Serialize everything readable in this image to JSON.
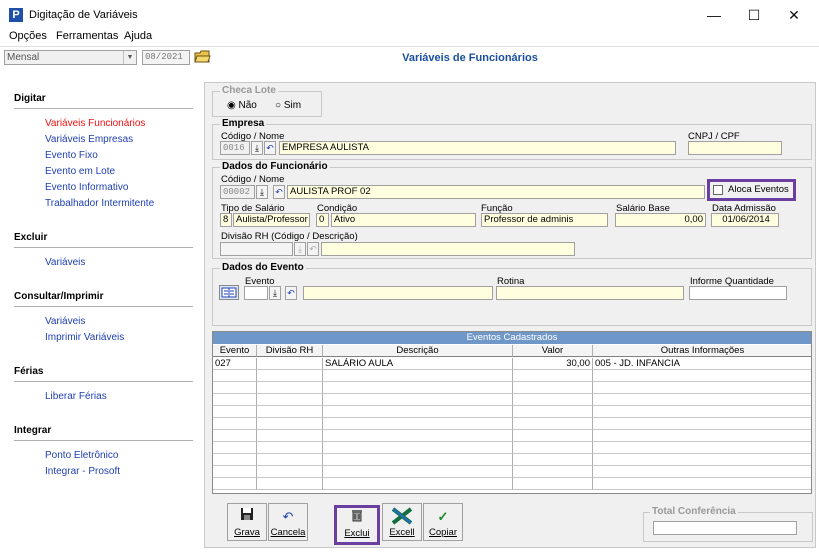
{
  "window": {
    "title": "Digitação de Variáveis",
    "app_icon": "P",
    "minimize": "—",
    "maximize": "☐",
    "close": "✕"
  },
  "menu": [
    "Opções",
    "Ferramentas",
    "Ajuda"
  ],
  "toolbar": {
    "period": "Mensal",
    "date": "08/2021",
    "heading": "Variáveis de Funcionários"
  },
  "sidebar": {
    "sections": [
      {
        "title": "Digitar",
        "items": [
          "Variáveis Funcionários",
          "Variáveis Empresas",
          "Evento Fixo",
          "Evento em Lote",
          "Evento Informativo",
          "Trabalhador Intermitente"
        ]
      },
      {
        "title": "Excluir",
        "items": [
          "Variáveis"
        ]
      },
      {
        "title": "Consultar/Imprimir",
        "items": [
          "Variáveis",
          "Imprimir Variáveis"
        ]
      },
      {
        "title": "Férias",
        "items": [
          "Liberar Férias"
        ]
      },
      {
        "title": "Integrar",
        "items": [
          "Ponto Eletrônico",
          "Integrar - Prosoft"
        ]
      }
    ]
  },
  "checa_lote": {
    "title": "Checa Lote",
    "no_label": "Não",
    "yes_label": "Sim",
    "selected": "Não"
  },
  "empresa": {
    "title": "Empresa",
    "code_label": "Código / Nome",
    "code": "0016",
    "name": "EMPRESA AULISTA",
    "cnpj_label": "CNPJ / CPF",
    "cnpj": ""
  },
  "funcionario": {
    "title": "Dados do Funcionário",
    "code_label": "Código / Nome",
    "code": "00002",
    "name": "AULISTA PROF 02",
    "aloca_label": "Aloca Eventos",
    "tipo_label": "Tipo de Salário",
    "tipo_code": "8",
    "tipo_name": "Aulista/Professor",
    "condicao_label": "Condição",
    "condicao_code": "0",
    "condicao_name": "Ativo",
    "funcao_label": "Função",
    "funcao": "Professor de adminis",
    "salario_label": "Salário Base",
    "salario": "0,00",
    "admissao_label": "Data Admissão",
    "admissao": "01/06/2014",
    "divisao_label": "Divisão RH (Código / Descrição)"
  },
  "evento": {
    "title": "Dados do Evento",
    "evento_label": "Evento",
    "rotina_label": "Rotina",
    "quantidade_label": "Informe Quantidade"
  },
  "grid": {
    "caption": "Eventos Cadastrados",
    "columns": [
      "Evento",
      "Divisão RH",
      "Descrição",
      "Valor",
      "Outras Informações"
    ],
    "rows": [
      [
        "027",
        "",
        "SALÁRIO AULA",
        "30,00",
        "005 - JD. INFANCIA"
      ]
    ]
  },
  "buttons": {
    "grava": "Grava",
    "cancela": "Cancela",
    "exclui": "Exclui",
    "excell": "Excell",
    "copiar": "Copiar"
  },
  "total": {
    "title": "Total Conferência",
    "value": ""
  },
  "colors": {
    "heading_blue": "#1a4fa0",
    "link_blue": "#1f3fb0",
    "active_red": "#ee1111",
    "highlight_purple": "#6b3fa0",
    "grid_caption": "#6f97c8",
    "input_yellow": "#ffffe0"
  }
}
